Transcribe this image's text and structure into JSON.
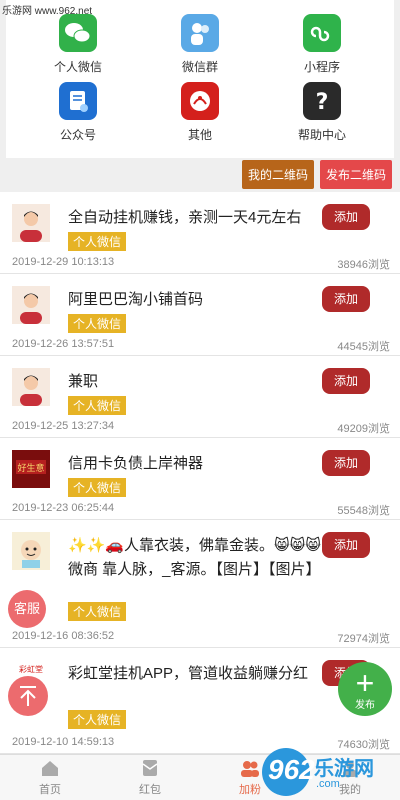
{
  "watermark": {
    "top_text": "乐游网 www.962.net",
    "brand_num": "962",
    "brand_cn": "乐游网",
    "brand_url": ".com"
  },
  "grid": [
    {
      "label": "个人微信",
      "icon": "wechat-icon"
    },
    {
      "label": "微信群",
      "icon": "group-icon"
    },
    {
      "label": "小程序",
      "icon": "mini-program-icon"
    },
    {
      "label": "公众号",
      "icon": "official-account-icon"
    },
    {
      "label": "其他",
      "icon": "other-icon"
    },
    {
      "label": "帮助中心",
      "icon": "help-icon"
    }
  ],
  "buttons": {
    "my_qr": "我的二维码",
    "publish_qr": "发布二维码",
    "add": "添加"
  },
  "posts": [
    {
      "title": "全自动挂机赚钱，亲测一天4元左右",
      "tag": "个人微信",
      "date": "2019-12-29 10:13:13",
      "views": "38946浏览",
      "avatar": "person"
    },
    {
      "title": "阿里巴巴淘小铺首码",
      "tag": "个人微信",
      "date": "2019-12-26 13:57:51",
      "views": "44545浏览",
      "avatar": "person"
    },
    {
      "title": "兼职",
      "tag": "个人微信",
      "date": "2019-12-25 13:27:34",
      "views": "49209浏览",
      "avatar": "person"
    },
    {
      "title": "信用卡负债上岸神器",
      "tag": "个人微信",
      "date": "2019-12-23 06:25:44",
      "views": "55548浏览",
      "avatar": "red-card"
    },
    {
      "title": "✨✨🚗人靠衣装，佛靠金装。😸😸😸 微商 靠人脉，_客源。【图片】【图片】",
      "tag": "个人微信",
      "date": "2019-12-16 08:36:52",
      "views": "72974浏览",
      "avatar": "cartoon"
    },
    {
      "title": "彩虹堂挂机APP，管道收益躺赚分红",
      "tag": "个人微信",
      "date": "2019-12-10 14:59:13",
      "views": "74630浏览",
      "avatar": "rainbow"
    }
  ],
  "floats": {
    "kefu": "客服",
    "publish": "发布"
  },
  "tabs": [
    {
      "label": "首页"
    },
    {
      "label": "红包"
    },
    {
      "label": "加粉"
    },
    {
      "label": "我的"
    }
  ],
  "colors": {
    "accent_red": "#b02a2a",
    "tag_yellow": "#e6b325",
    "float_green": "#43b04a"
  }
}
